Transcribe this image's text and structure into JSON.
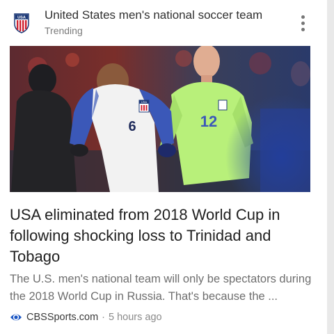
{
  "topic": {
    "crest_text": "USA",
    "title": "United States men's national soccer team",
    "subtitle": "Trending"
  },
  "hero": {
    "jersey_left": "6",
    "jersey_right": "12",
    "crest_small": "USA"
  },
  "article": {
    "headline": "USA eliminated from 2018 World Cup in following shocking loss to Trinidad and Tobago",
    "snippet": "The U.S. men's national team will only be spectators during the 2018 World Cup in Russia. That's because the ..."
  },
  "source": {
    "name": "CBSSports.com",
    "separator": "·",
    "time": "5 hours ago",
    "icon": "cbs-eye-icon"
  },
  "colors": {
    "eye_blue": "#1a56c4",
    "keeper_green": "#b8f07a",
    "kit_white": "#f2f2f2",
    "sleeve_blue": "#3b58b8"
  }
}
